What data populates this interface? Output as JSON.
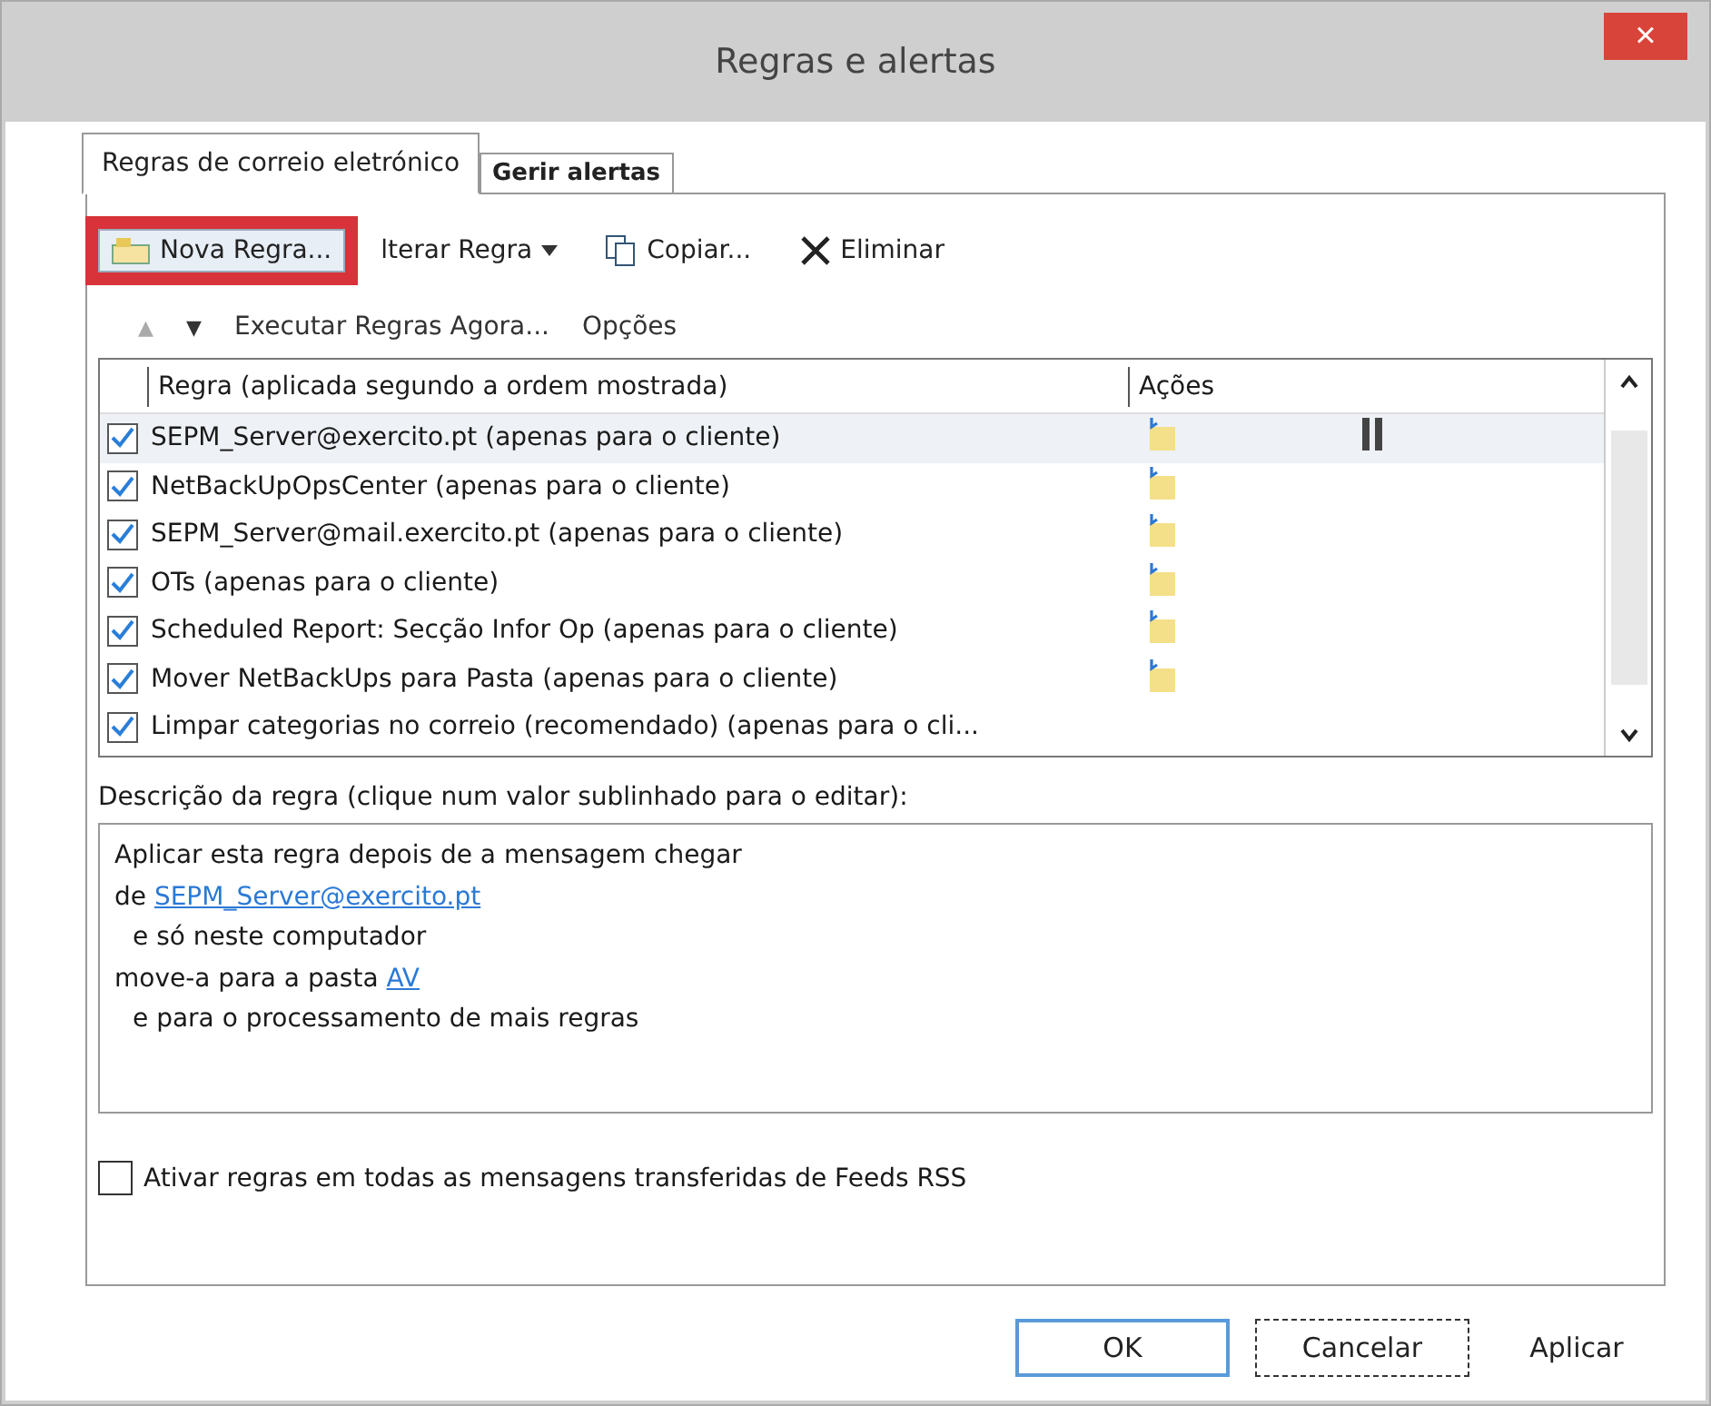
{
  "window": {
    "title": "Regras e alertas",
    "close": "×"
  },
  "tabs": [
    {
      "label": "Regras de correio eletrónico",
      "selected": true
    },
    {
      "label": "Gerir alertas",
      "selected": false
    }
  ],
  "toolbar": [
    {
      "kind": "new",
      "label": "Nova Regra...",
      "highlighted": true
    },
    {
      "kind": "change",
      "label": "lterar Regra",
      "highlighted": false
    },
    {
      "kind": "copy",
      "label": "Copiar...",
      "highlighted": false
    },
    {
      "kind": "delete",
      "label": "Eliminar",
      "highlighted": false
    }
  ],
  "toolbar2": [
    {
      "kind": "up",
      "label": "▲"
    },
    {
      "kind": "down",
      "label": "▼"
    },
    {
      "kind": "text",
      "label": "Executar Regras Agora..."
    },
    {
      "kind": "text",
      "label": "Opções"
    }
  ],
  "table": {
    "columns": [
      "Regra (aplicada segundo a ordem mostrada)",
      "Ações"
    ],
    "rows": [
      {
        "checked": true,
        "name": "SEPM_Server@exercito.pt  (apenas para o cliente)",
        "action": true,
        "selected": true
      },
      {
        "checked": true,
        "name": "NetBackUpOpsCenter  (apenas para o cliente)",
        "action": true,
        "selected": false
      },
      {
        "checked": true,
        "name": "SEPM_Server@mail.exercito.pt  (apenas para o cliente)",
        "action": true,
        "selected": false
      },
      {
        "checked": true,
        "name": "OTs  (apenas para o cliente)",
        "action": true,
        "selected": false
      },
      {
        "checked": true,
        "name": "Scheduled Report: Secção Infor Op  (apenas para o cliente)",
        "action": true,
        "selected": false
      },
      {
        "checked": true,
        "name": "Mover NetBackUps para Pasta  (apenas para o cliente)",
        "action": true,
        "selected": false
      },
      {
        "checked": true,
        "name": "Limpar categorias no correio (recomendado)  (apenas para o cli...",
        "action": false,
        "selected": false
      }
    ]
  },
  "description": {
    "label": "Descrição da regra (clique num valor sublinhado para o editar):",
    "lines": [
      {
        "text": "Aplicar esta regra depois de a mensagem chegar",
        "indent": false
      },
      {
        "text": "de",
        "link": "SEPM_Server@exercito.pt",
        "indent": false
      },
      {
        "text": "e só neste computador",
        "indent": true
      },
      {
        "text": "move-a para a pasta",
        "link": "AV",
        "indent": false
      },
      {
        "text": "e para o processamento de mais regras",
        "indent": true
      }
    ]
  },
  "rss": {
    "label": "Ativar regras em todas as mensagens transferidas de Feeds RSS",
    "checked": false
  },
  "buttons": [
    {
      "kind": "default",
      "label": "OK"
    },
    {
      "kind": "focus",
      "label": "Cancelar"
    },
    {
      "kind": "flat",
      "label": "Aplicar"
    }
  ]
}
